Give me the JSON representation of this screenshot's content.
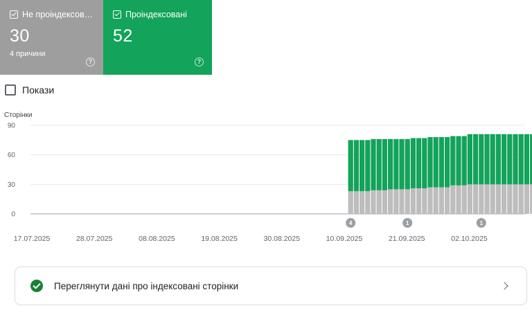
{
  "cards": {
    "not_indexed": {
      "label": "Не проіндексова...",
      "value": "30",
      "subtitle": "4 причини",
      "help": "?"
    },
    "indexed": {
      "label": "Проіндексовані",
      "value": "52",
      "help": "?"
    }
  },
  "show_toggle": {
    "label": "Покази",
    "checked": false
  },
  "chart_data": {
    "type": "bar",
    "stacked": true,
    "ylabel": "Сторінки",
    "yticks": [
      "0",
      "30",
      "60",
      "90"
    ],
    "ylim": [
      0,
      90
    ],
    "xticks": [
      "17.07.2025",
      "28.07.2025",
      "08.08.2025",
      "19.08.2025",
      "30.08.2025",
      "10.09.2025",
      "21.09.2025",
      "02.10.2025"
    ],
    "x_start": "2025-07-17",
    "day_count": 90,
    "colors": {
      "not_indexed": "#bdbdbd",
      "indexed": "#13a35a"
    },
    "dates": [
      "2025-09-11",
      "2025-09-12",
      "2025-09-13",
      "2025-09-14",
      "2025-09-15",
      "2025-09-16",
      "2025-09-17",
      "2025-09-18",
      "2025-09-19",
      "2025-09-20",
      "2025-09-21",
      "2025-09-22",
      "2025-09-23",
      "2025-09-24",
      "2025-09-25",
      "2025-09-26",
      "2025-09-27",
      "2025-09-28",
      "2025-09-29",
      "2025-09-30",
      "2025-10-01",
      "2025-10-02",
      "2025-10-03",
      "2025-10-04",
      "2025-10-05",
      "2025-10-06",
      "2025-10-07",
      "2025-10-08",
      "2025-10-09",
      "2025-10-10",
      "2025-10-11",
      "2025-10-12",
      "2025-10-13"
    ],
    "series": [
      {
        "key": "not_indexed",
        "values": [
          23,
          23,
          23,
          23,
          24,
          24,
          24,
          25,
          25,
          25,
          25,
          26,
          26,
          26,
          27,
          27,
          27,
          27,
          29,
          29,
          29,
          30,
          30,
          30,
          30,
          30,
          30,
          30,
          30,
          30,
          30,
          30,
          30
        ]
      },
      {
        "key": "indexed",
        "values": [
          52,
          52,
          52,
          52,
          52,
          52,
          52,
          51,
          51,
          51,
          51,
          51,
          51,
          51,
          51,
          51,
          51,
          51,
          50,
          50,
          50,
          51,
          51,
          51,
          51,
          51,
          51,
          51,
          51,
          51,
          51,
          51,
          51
        ]
      }
    ],
    "annotations": [
      {
        "date": "2025-09-11",
        "label": "4"
      },
      {
        "date": "2025-09-21",
        "label": "1"
      },
      {
        "date": "2025-10-04",
        "label": "1"
      }
    ]
  },
  "link": {
    "label": "Переглянути дані про індексовані сторінки"
  }
}
